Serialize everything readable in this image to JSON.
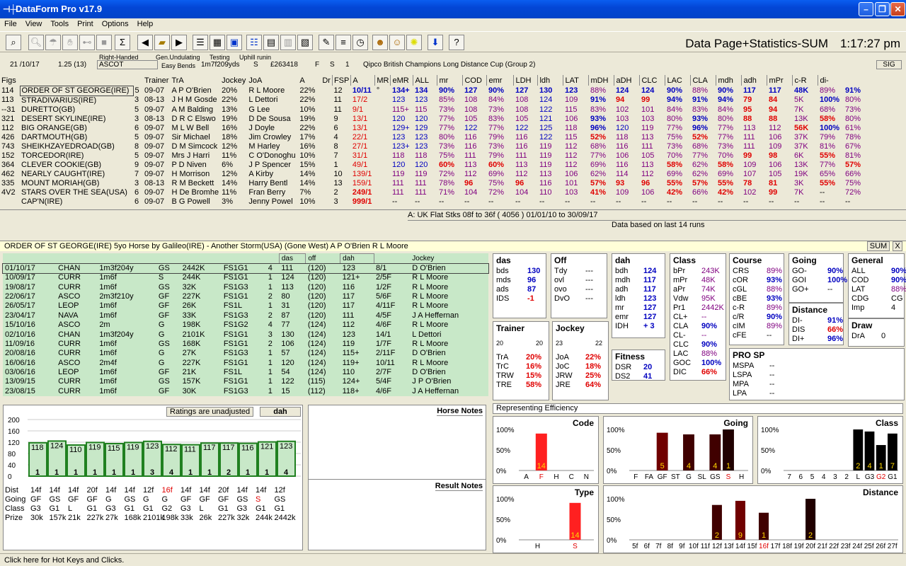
{
  "app": {
    "title": "DataForm Pro v17.9"
  },
  "menu": [
    "File",
    "View",
    "Tools",
    "Print",
    "Options",
    "Help"
  ],
  "toolbar": {
    "page_title": "Data Page+Statistics-SUM",
    "clock": "1:17:27 pm",
    "sigma": "Σ",
    "help": "?"
  },
  "race": {
    "handed": "Right-Handed",
    "course_type": "Gen.Undulating",
    "bends": "Easy Bends",
    "testing": "Testing",
    "uphill": "Uphill runin",
    "date": "21 /10/17",
    "time": "1.25 (13)",
    "course": "ASCOT",
    "dist": "1m7f209yds",
    "going": "S",
    "prize": "£263418",
    "f": "F",
    "s": "S",
    "one": "1",
    "race_name": "Qipco British Champions Long Distance Cup (Group 2)",
    "sig": "SIG"
  },
  "columns": [
    "Figs",
    "",
    "",
    "Trainer",
    "TrA",
    "Jockey",
    "JoA",
    "A",
    "Dr",
    "FSP",
    "A",
    "MR",
    "eMR",
    "ALL",
    "mr",
    "COD",
    "emr",
    "LDH",
    "ldh",
    "LAT",
    "mDH",
    "aDH",
    "CLC",
    "LAC",
    "CLA",
    "mdh",
    "adh",
    "mPr",
    "c-R",
    "di-"
  ],
  "runners": [
    [
      "114",
      "ORDER OF ST GEORGE(IRE)",
      "5",
      "09-07",
      "A P O'Brien",
      "20%",
      "R L Moore",
      "22%",
      "",
      "12",
      "10/11",
      "°",
      "134+",
      "134",
      "90%",
      "127",
      "90%",
      "127",
      "130",
      "123",
      "88%",
      "124",
      "124",
      "90%",
      "88%",
      "90%",
      "117",
      "117",
      "48K",
      "89%",
      "91%"
    ],
    [
      "113",
      "STRADIVARIUS(IRE)",
      "3",
      "08-13",
      "J H M Gosde",
      "22%",
      "L Dettori",
      "22%",
      "",
      "11",
      "17/2",
      "",
      "123",
      "123",
      "85%",
      "108",
      "84%",
      "108",
      "124",
      "109",
      "91%",
      "94",
      "99",
      "94%",
      "91%",
      "94%",
      "79",
      "84",
      "5K",
      "100%",
      "80%"
    ],
    [
      "--31",
      "DURETTO(GB)",
      "5",
      "09-07",
      "A M Balding",
      "13%",
      "G Lee",
      "10%",
      "",
      "11",
      "9/1",
      "",
      "115+",
      "115",
      "73%",
      "108",
      "73%",
      "108",
      "122",
      "115",
      "83%",
      "102",
      "101",
      "84%",
      "83%",
      "84%",
      "95",
      "94",
      "7K",
      "68%",
      "73%"
    ],
    [
      "321",
      "DESERT SKYLINE(IRE)",
      "3",
      "08-13",
      "D R C Elswo",
      "19%",
      "D De Sousa",
      "19%",
      "",
      "9",
      "13/1",
      "",
      "120",
      "120",
      "77%",
      "105",
      "83%",
      "105",
      "121",
      "106",
      "93%",
      "103",
      "103",
      "80%",
      "93%",
      "80%",
      "88",
      "88",
      "13K",
      "58%",
      "80%"
    ],
    [
      "112",
      "BIG ORANGE(GB)",
      "6",
      "09-07",
      "M L W Bell",
      "16%",
      "J Doyle",
      "22%",
      "",
      "6",
      "13/1",
      "",
      "129+",
      "129",
      "77%",
      "122",
      "77%",
      "122",
      "125",
      "118",
      "96%",
      "120",
      "119",
      "77%",
      "96%",
      "77%",
      "113",
      "112",
      "56K",
      "100%",
      "61%"
    ],
    [
      "426",
      "DARTMOUTH(GB)",
      "5",
      "09-07",
      "Sir Michael",
      "18%",
      "Jim Crowley",
      "17%",
      "",
      "4",
      "22/1",
      "",
      "123",
      "123",
      "80%",
      "116",
      "79%",
      "116",
      "122",
      "115",
      "52%",
      "118",
      "113",
      "75%",
      "52%",
      "77%",
      "111",
      "106",
      "37K",
      "79%",
      "78%"
    ],
    [
      "743",
      "SHEIKHZAYEDROAD(GB)",
      "8",
      "09-07",
      "D M Simcock",
      "12%",
      "M Harley",
      "16%",
      "",
      "8",
      "27/1",
      "",
      "123+",
      "123",
      "73%",
      "116",
      "73%",
      "116",
      "119",
      "112",
      "68%",
      "116",
      "111",
      "73%",
      "68%",
      "73%",
      "111",
      "109",
      "37K",
      "81%",
      "67%"
    ],
    [
      "152",
      "TORCEDOR(IRE)",
      "5",
      "09-07",
      "Mrs J Harri",
      "11%",
      "C O'Donoghu",
      "10%",
      "",
      "7",
      "31/1",
      "",
      "118",
      "118",
      "75%",
      "111",
      "79%",
      "111",
      "119",
      "112",
      "77%",
      "106",
      "105",
      "70%",
      "77%",
      "70%",
      "99",
      "98",
      "6K",
      "55%",
      "81%"
    ],
    [
      "364",
      "CLEVER COOKIE(GB)",
      "9",
      "09-07",
      "P D Niven",
      "6%",
      "J P Spencer",
      "15%",
      "",
      "1",
      "49/1",
      "",
      "120",
      "120",
      "60%",
      "113",
      "60%",
      "113",
      "119",
      "112",
      "69%",
      "116",
      "113",
      "58%",
      "62%",
      "58%",
      "109",
      "106",
      "13K",
      "77%",
      "57%"
    ],
    [
      "462",
      "NEARLY CAUGHT(IRE)",
      "7",
      "09-07",
      "H Morrison",
      "12%",
      "A Kirby",
      "14%",
      "",
      "10",
      "139/1",
      "",
      "119",
      "119",
      "72%",
      "112",
      "69%",
      "112",
      "113",
      "106",
      "62%",
      "114",
      "112",
      "69%",
      "62%",
      "69%",
      "107",
      "105",
      "19K",
      "65%",
      "66%"
    ],
    [
      "335",
      "MOUNT MORIAH(GB)",
      "3",
      "08-13",
      "R M Beckett",
      "14%",
      "Harry Bentl",
      "14%",
      "",
      "13",
      "159/1",
      "",
      "111",
      "111",
      "78%",
      "96",
      "75%",
      "96",
      "116",
      "101",
      "57%",
      "93",
      "96",
      "55%",
      "57%",
      "55%",
      "78",
      "81",
      "3K",
      "55%",
      "75%"
    ],
    [
      "4V2",
      "STARS OVER THE SEA(USA)",
      "6",
      "09-07",
      "H De Bromhe",
      "11%",
      "Fran Berry",
      "7%",
      "",
      "2",
      "249/1",
      "",
      "111",
      "111",
      "71%",
      "104",
      "72%",
      "104",
      "110",
      "103",
      "41%",
      "109",
      "106",
      "42%",
      "66%",
      "42%",
      "102",
      "99",
      "7K",
      "--",
      "72%"
    ],
    [
      "",
      "CAP'N(IRE)",
      "6",
      "09-07",
      "B G Powell",
      "3%",
      "Jenny Powel",
      "10%",
      "",
      "3",
      "999/1",
      "",
      "--",
      "--",
      "--",
      "--",
      "--",
      "--",
      "--",
      "--",
      "--",
      "--",
      "--",
      "--",
      "--",
      "--",
      "--",
      "--",
      "--",
      "--",
      "--"
    ]
  ],
  "filter": {
    "line": "A: UK Flat Stks 08f to 36f ( 4056 )   01/01/10 to 30/09/17",
    "based": "Data based on last 14 runs"
  },
  "horse": {
    "header": "ORDER OF ST GEORGE(IRE)   5yo Horse by Galileo(IRE) - Another Storm(USA) (Gone West)   A P O'Brien   R L Moore",
    "sum": "SUM",
    "close": "X"
  },
  "form_cols": [
    "das",
    "off",
    "dah",
    "Jockey"
  ],
  "form": [
    [
      "01/10/17",
      "CHAN",
      "1m3f204y",
      "GS",
      "2442K",
      "FS1G1",
      "4",
      "111",
      "(120)",
      "123",
      "8/1",
      "D O'Brien"
    ],
    [
      "10/09/17",
      "CURR",
      "1m6f",
      "S",
      "244K",
      "FS1G1",
      "1",
      "124",
      "(120)",
      "121+",
      "2/5F",
      "R L Moore"
    ],
    [
      "19/08/17",
      "CURR",
      "1m6f",
      "GS",
      "32K",
      "FS1G3",
      "1",
      "113",
      "(120)",
      "116",
      "1/2F",
      "R L Moore"
    ],
    [
      "22/06/17",
      "ASCO",
      "2m3f210y",
      "GF",
      "227K",
      "FS1G1",
      "2",
      "80",
      "(120)",
      "117",
      "5/6F",
      "R L Moore"
    ],
    [
      "26/05/17",
      "LEOP",
      "1m6f",
      "GF",
      "26K",
      "FS1L",
      "1",
      "31",
      "(120)",
      "117",
      "4/11F",
      "R L Moore"
    ],
    [
      "23/04/17",
      "NAVA",
      "1m6f",
      "GF",
      "33K",
      "FS1G3",
      "2",
      "87",
      "(120)",
      "111",
      "4/5F",
      "J A Heffernan"
    ],
    [
      "15/10/16",
      "ASCO",
      "2m",
      "G",
      "198K",
      "FS1G2",
      "4",
      "77",
      "(124)",
      "112",
      "4/6F",
      "R L Moore"
    ],
    [
      "02/10/16",
      "CHAN",
      "1m3f204y",
      "G",
      "2101K",
      "FS1G1",
      "3",
      "130",
      "(124)",
      "123",
      "14/1",
      "L Dettori"
    ],
    [
      "11/09/16",
      "CURR",
      "1m6f",
      "GS",
      "168K",
      "FS1G1",
      "2",
      "106",
      "(124)",
      "119",
      "1/7F",
      "R L Moore"
    ],
    [
      "20/08/16",
      "CURR",
      "1m6f",
      "G",
      "27K",
      "FS1G3",
      "1",
      "57",
      "(124)",
      "115+",
      "2/11F",
      "D O'Brien"
    ],
    [
      "16/06/16",
      "ASCO",
      "2m4f",
      "G",
      "227K",
      "FS1G1",
      "1",
      "120",
      "(124)",
      "119+",
      "10/11",
      "R L Moore"
    ],
    [
      "03/06/16",
      "LEOP",
      "1m6f",
      "GF",
      "21K",
      "FS1L",
      "1",
      "54",
      "(124)",
      "110",
      "2/7F",
      "D O'Brien"
    ],
    [
      "13/09/15",
      "CURR",
      "1m6f",
      "GS",
      "157K",
      "FS1G1",
      "1",
      "122",
      "(115)",
      "124+",
      "5/4F",
      "J P O'Brien"
    ],
    [
      "23/08/15",
      "CURR",
      "1m6f",
      "GF",
      "30K",
      "FS1G3",
      "1",
      "15",
      "(112)",
      "118+",
      "4/6F",
      "J A Heffernan"
    ]
  ],
  "stats": {
    "das": {
      "title": "das",
      "rows": [
        [
          "bds",
          "130"
        ],
        [
          "mds",
          "96"
        ],
        [
          "ads",
          "87"
        ],
        [
          "IDS",
          "-1"
        ]
      ]
    },
    "off": {
      "title": "Off",
      "rows": [
        [
          "Tdy",
          "---"
        ],
        [
          "ovl",
          "---"
        ],
        [
          "ovo",
          "---"
        ],
        [
          "DvO",
          "---"
        ]
      ]
    },
    "dah": {
      "title": "dah",
      "rows": [
        [
          "bdh",
          "124"
        ],
        [
          "mdh",
          "117"
        ],
        [
          "adh",
          "117"
        ],
        [
          "ldh",
          "123"
        ],
        [
          "mr",
          "127"
        ],
        [
          "emr",
          "127"
        ],
        [
          "IDH",
          "+ 3"
        ]
      ]
    },
    "class": {
      "title": "Class",
      "rows": [
        [
          "bPr",
          "243K"
        ],
        [
          "mPr",
          "48K"
        ],
        [
          "aPr",
          "74K"
        ],
        [
          "Vdw",
          "95K"
        ],
        [
          "Pr1",
          "2442K"
        ],
        [
          "CL+",
          "--"
        ],
        [
          "CLA",
          "90%"
        ],
        [
          "CL-",
          "--"
        ],
        [
          "CLC",
          "90%"
        ],
        [
          "LAC",
          "88%"
        ],
        [
          "GOC",
          "100%"
        ],
        [
          "DIC",
          "66%"
        ]
      ]
    },
    "course": {
      "title": "Course",
      "rows": [
        [
          "CRS",
          "89%"
        ],
        [
          "cOR",
          "93%"
        ],
        [
          "cGL",
          "88%"
        ],
        [
          "cBE",
          "93%"
        ],
        [
          "c-R",
          "89%"
        ],
        [
          "c/R",
          "90%"
        ],
        [
          "cIM",
          "89%"
        ],
        [
          "cFE",
          "--"
        ]
      ]
    },
    "going": {
      "title": "Going",
      "rows": [
        [
          "GO-",
          "90%"
        ],
        [
          "GOI",
          "100%"
        ],
        [
          "GO+",
          "--"
        ]
      ]
    },
    "distance": {
      "title": "Distance",
      "rows": [
        [
          "DI-",
          "91%"
        ],
        [
          "DIS",
          "66%"
        ],
        [
          "DI+",
          "96%"
        ]
      ]
    },
    "general": {
      "title": "General",
      "rows": [
        [
          "ALL",
          "90%"
        ],
        [
          "COD",
          "90%"
        ],
        [
          "LAT",
          "88%"
        ],
        [
          "CDG",
          "CG"
        ],
        [
          "Imp",
          "4"
        ]
      ]
    },
    "draw": {
      "title": "Draw",
      "rows": [
        [
          "DrA",
          "0"
        ]
      ]
    },
    "trainer": {
      "title": "Trainer",
      "l": "20",
      "r": "20",
      "rows": [
        [
          "TrA",
          "20%"
        ],
        [
          "TrC",
          "16%"
        ],
        [
          "TRW",
          "15%"
        ],
        [
          "TRE",
          "58%"
        ]
      ]
    },
    "jockey": {
      "title": "Jockey",
      "l": "23",
      "r": "22",
      "rows": [
        [
          "JoA",
          "22%"
        ],
        [
          "JoC",
          "18%"
        ],
        [
          "JRW",
          "25%"
        ],
        [
          "JRE",
          "64%"
        ]
      ]
    },
    "fitness": {
      "title": "Fitness",
      "rows": [
        [
          "DSR",
          "20"
        ],
        [
          "DS2",
          "41"
        ]
      ]
    },
    "prosp": {
      "title": "PRO SP",
      "rows": [
        [
          "MSPA",
          "--"
        ],
        [
          "LSPA",
          "--"
        ],
        [
          "MPA",
          "--"
        ],
        [
          "LPA",
          "--"
        ]
      ],
      "val": "--"
    }
  },
  "ratings_chart": {
    "label": "Ratings are unadjusted",
    "btn": "dah",
    "yticks": [
      "200",
      "160",
      "120",
      "80",
      "40",
      "0"
    ],
    "values": [
      118,
      124,
      110,
      119,
      115,
      119,
      123,
      112,
      111,
      117,
      117,
      116,
      121,
      123
    ],
    "positions": [
      "1",
      "1",
      "1",
      "1",
      "1",
      "1",
      "3",
      "4",
      "1",
      "1",
      "2",
      "1",
      "1",
      "4"
    ],
    "rows": {
      "Dist": [
        "14f",
        "14f",
        "14f",
        "20f",
        "14f",
        "14f",
        "12f",
        "16f",
        "14f",
        "14f",
        "20f",
        "14f",
        "14f",
        "12f"
      ],
      "Going": [
        "GF",
        "GS",
        "GF",
        "GF",
        "G",
        "GS",
        "G",
        "G",
        "GF",
        "GF",
        "GF",
        "GS",
        "S",
        "GS"
      ],
      "Class": [
        "G3",
        "G1",
        "L",
        "G1",
        "G3",
        "G1",
        "G1",
        "G2",
        "G3",
        "L",
        "G1",
        "G3",
        "G1",
        "G1"
      ],
      "Prize": [
        "30k",
        "157k",
        "21k",
        "227k",
        "27k",
        "168k",
        "2101k",
        "198k",
        "33k",
        "26k",
        "227k",
        "32k",
        "244k",
        "2442k"
      ]
    }
  },
  "notes": {
    "horse": "Horse Notes",
    "result": "Result Notes"
  },
  "efficiency": {
    "title": "Representing Efficiency",
    "code": {
      "title": "Code",
      "cats": [
        "A",
        "F",
        "H",
        "C",
        "N"
      ],
      "vals": [
        0,
        90,
        0,
        0,
        0
      ],
      "nums": [
        "",
        "14",
        "",
        "",
        ""
      ]
    },
    "going": {
      "title": "Going",
      "cats": [
        "F",
        "FA",
        "GF",
        "ST",
        "G",
        "SL",
        "GS",
        "S",
        "H"
      ],
      "vals": [
        0,
        0,
        92,
        0,
        88,
        0,
        88,
        100,
        0
      ],
      "nums": [
        "",
        "",
        "5",
        "",
        "4",
        "",
        "4",
        "1",
        ""
      ]
    },
    "class": {
      "title": "Class",
      "cats": [
        "7",
        "6",
        "5",
        "4",
        "3",
        "2",
        "L",
        "G3",
        "G2",
        "G1"
      ],
      "vals": [
        0,
        0,
        0,
        0,
        0,
        0,
        100,
        95,
        62,
        90
      ],
      "nums": [
        "",
        "",
        "",
        "",
        "",
        "",
        "2",
        "4",
        "1",
        "7"
      ]
    },
    "type": {
      "title": "Type",
      "cats": [
        "H",
        "S"
      ],
      "vals": [
        0,
        90
      ],
      "nums": [
        "",
        "14"
      ]
    },
    "distance": {
      "title": "Distance",
      "cats": [
        "5f",
        "6f",
        "7f",
        "8f",
        "9f",
        "10f",
        "11f",
        "12f",
        "13f",
        "14f",
        "15f",
        "16f",
        "17f",
        "18f",
        "19f",
        "20f",
        "21f",
        "22f",
        "23f",
        "24f",
        "25f",
        "26f",
        "27f"
      ],
      "vals": [
        0,
        0,
        0,
        0,
        0,
        0,
        0,
        85,
        0,
        95,
        0,
        66,
        0,
        0,
        0,
        100,
        0,
        0,
        0,
        0,
        0,
        0,
        0
      ],
      "nums": [
        "",
        "",
        "",
        "",
        "",
        "",
        "",
        "2",
        "",
        "9",
        "",
        "1",
        "",
        "",
        "",
        "2",
        "",
        "",
        "",
        "",
        "",
        "",
        ""
      ]
    },
    "axis": [
      "100%",
      "50%",
      "0%"
    ]
  },
  "status": "Click here for Hot Keys and Clicks."
}
